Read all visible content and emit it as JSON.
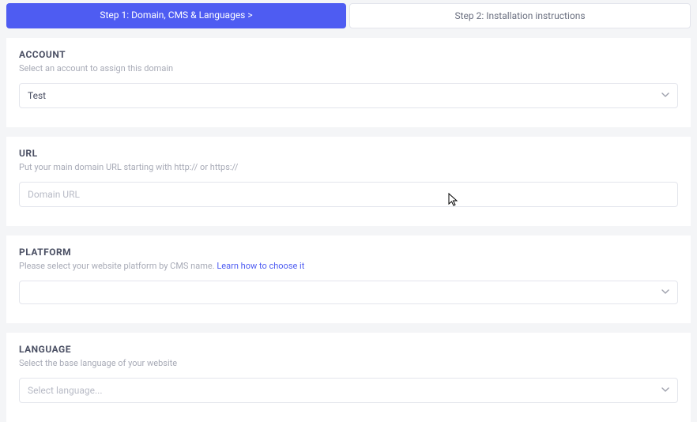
{
  "tabs": {
    "step1": "Step 1: Domain, CMS & Languages  >",
    "step2": "Step 2: Installation instructions"
  },
  "account": {
    "title": "ACCOUNT",
    "desc": "Select an account to assign this domain",
    "value": "Test"
  },
  "url": {
    "title": "URL",
    "desc": "Put your main domain URL starting with http:// or https://",
    "placeholder": "Domain URL"
  },
  "platform": {
    "title": "PLATFORM",
    "desc": "Please select your website platform by CMS name.  ",
    "link": "Learn how to choose it",
    "value": ""
  },
  "language": {
    "title": "LANGUAGE",
    "desc": "Select the base language of your website",
    "value": "Select language..."
  }
}
